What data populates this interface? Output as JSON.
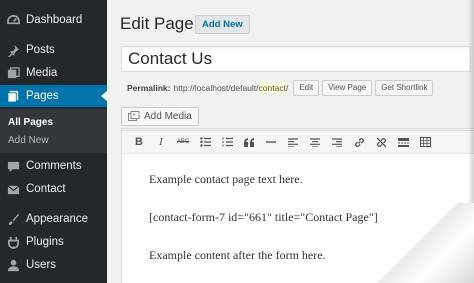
{
  "sidebar": {
    "items": [
      {
        "label": "Dashboard",
        "icon": "dashboard-icon"
      },
      {
        "label": "Posts",
        "icon": "pin-icon"
      },
      {
        "label": "Media",
        "icon": "media-icon"
      },
      {
        "label": "Pages",
        "icon": "pages-icon"
      },
      {
        "label": "Comments",
        "icon": "comment-icon"
      },
      {
        "label": "Contact",
        "icon": "mail-icon"
      },
      {
        "label": "Appearance",
        "icon": "brush-icon"
      },
      {
        "label": "Plugins",
        "icon": "plugin-icon"
      },
      {
        "label": "Users",
        "icon": "user-icon"
      }
    ],
    "submenu": {
      "all_pages": "All Pages",
      "add_new": "Add New"
    },
    "accent": "#0073aa",
    "background": "#23282d"
  },
  "header": {
    "title": "Edit Page",
    "add_new_label": "Add New"
  },
  "post": {
    "title": "Contact Us",
    "permalink_label": "Permalink:",
    "permalink_base": "http://localhost/default/",
    "permalink_slug": "contact",
    "permalink_trailing": "/",
    "edit_label": "Edit",
    "view_label": "View Page",
    "shortlink_label": "Get Shortlink"
  },
  "media": {
    "add_media_label": "Add Media"
  },
  "toolbar": {
    "buttons": [
      "bold-icon",
      "italic-icon",
      "strikethrough-icon",
      "bullet-list-icon",
      "numbered-list-icon",
      "blockquote-icon",
      "horizontal-rule-icon",
      "align-left-icon",
      "align-center-icon",
      "align-right-icon",
      "link-icon",
      "unlink-icon",
      "read-more-icon",
      "toolbar-toggle-icon"
    ],
    "bold": "B",
    "italic": "I",
    "strike": "ABC"
  },
  "editor": {
    "line1": "Example contact page text here.",
    "line2": "[contact-form-7 id=\"661\" title=\"Contact Page\"]",
    "line3": "Example content after the form here."
  }
}
